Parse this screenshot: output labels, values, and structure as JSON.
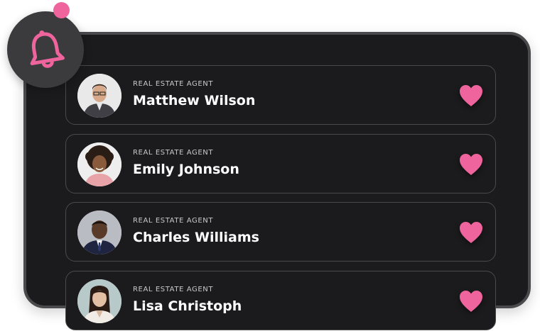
{
  "accent_color": "#f0649e",
  "header": {
    "icon": "bell-icon",
    "has_notification": true
  },
  "agents": [
    {
      "role": "REAL ESTATE AGENT",
      "name": "Matthew Wilson",
      "favorite": true
    },
    {
      "role": "REAL ESTATE AGENT",
      "name": "Emily Johnson",
      "favorite": true
    },
    {
      "role": "REAL ESTATE AGENT",
      "name": "Charles Williams",
      "favorite": true
    },
    {
      "role": "REAL ESTATE AGENT",
      "name": "Lisa Christoph",
      "favorite": true
    }
  ]
}
